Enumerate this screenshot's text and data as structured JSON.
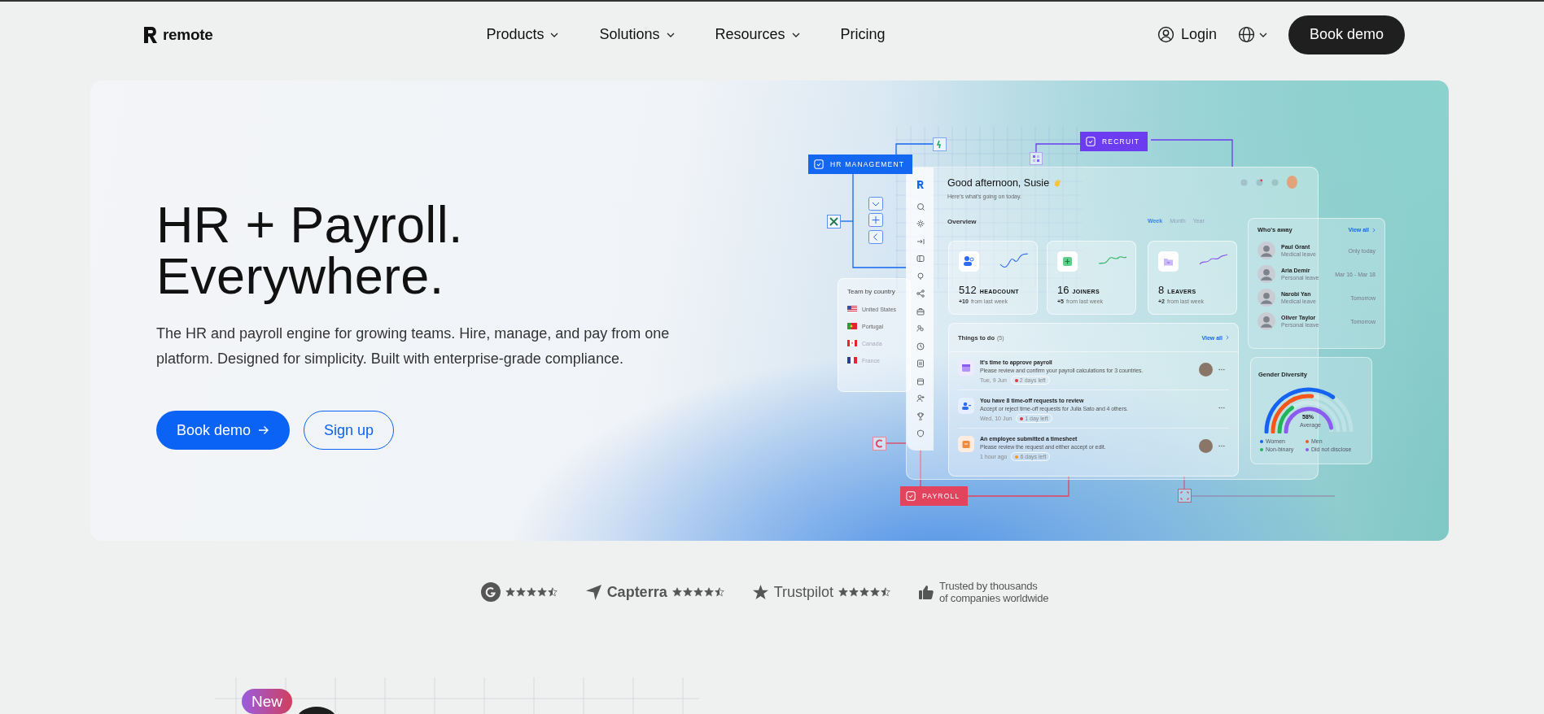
{
  "header": {
    "logo": "remote",
    "nav": [
      {
        "label": "Products",
        "dropdown": true
      },
      {
        "label": "Solutions",
        "dropdown": true
      },
      {
        "label": "Resources",
        "dropdown": true
      },
      {
        "label": "Pricing",
        "dropdown": false
      }
    ],
    "login": "Login",
    "cta": "Book demo"
  },
  "hero": {
    "title_lines": [
      "HR + Payroll.",
      "Everywhere."
    ],
    "description": "The HR and payroll engine for growing teams. Hire, manage, and pay from one platform. Designed for simplicity. Built with enterprise-grade compliance.",
    "buttons": [
      {
        "label": "Book demo",
        "kind": "primary"
      },
      {
        "label": "Sign up",
        "kind": "outline"
      }
    ]
  },
  "illustration": {
    "tags": [
      {
        "label": "HR MANAGEMENT",
        "color": "#1467f0"
      },
      {
        "label": "RECRUIT",
        "color": "#6b3cf0"
      },
      {
        "label": "PAYROLL",
        "color": "#e2435d"
      }
    ],
    "team_by_country": {
      "title": "Team by country",
      "countries": [
        {
          "name": "United States",
          "kind": "us"
        },
        {
          "name": "Portugal",
          "kind": "pt"
        },
        {
          "name": "Canada",
          "kind": "ca"
        },
        {
          "name": "France",
          "kind": "fr"
        }
      ]
    },
    "dashboard": {
      "greeting": "Good afternoon, Susie",
      "subtitle": "Here's what's going on today.",
      "overview": "Overview",
      "periods": [
        {
          "label": "Week",
          "selected": true
        },
        {
          "label": "Month",
          "selected": false
        },
        {
          "label": "Year",
          "selected": false
        }
      ],
      "stats": [
        {
          "kind": "headcount",
          "value": "512",
          "label": "HEADCOUNT",
          "change": "+10",
          "note": "from last week"
        },
        {
          "kind": "joiners",
          "value": "16",
          "label": "JOINERS",
          "change": "+5",
          "note": "from last week"
        },
        {
          "kind": "leavers",
          "value": "8",
          "label": "LEAVERS",
          "change": "+2",
          "note": "from last week"
        }
      ],
      "todo": {
        "title": "Things to do",
        "count": "(5)",
        "view_all": "View all",
        "items": [
          {
            "kind": "payroll",
            "title": "It's time to approve payroll",
            "description": "Please review and confirm your payroll calculations for 3 countries.",
            "date": "Tue, 9 Jun",
            "due": "2 days left",
            "color": "#e5363d",
            "avatar": true
          },
          {
            "kind": "time-off",
            "title": "You have 8 time-off requests to review",
            "description": "Accept or reject time-off requests for Julia Sato and 4 others.",
            "date": "Wed, 10 Jun",
            "due": "1 day left",
            "color": "#e5363d",
            "avatar": false
          },
          {
            "kind": "timesheet",
            "title": "An employee submitted a timesheet",
            "description": "Please review the request and either accept or edit.",
            "date": "1 hour ago",
            "due": "6 days left",
            "color": "#f39a1e",
            "avatar": true
          }
        ]
      }
    },
    "away": {
      "title": "Who's away",
      "view_all": "View all",
      "people": [
        {
          "name": "Paul Grant",
          "reason": "Medical leave",
          "when": "Only today"
        },
        {
          "name": "Aria Demir",
          "reason": "Personal leave",
          "when": "Mar 16 - Mar 18"
        },
        {
          "name": "Narobi Yan",
          "reason": "Medical leave",
          "when": "Tomorrow"
        },
        {
          "name": "Oliver Taylor",
          "reason": "Personal leave",
          "when": "Tomorrow"
        }
      ]
    },
    "gender": {
      "title": "Gender Diversity",
      "value": "58%",
      "caption": "Average",
      "legend": [
        {
          "label": "Women",
          "color": "#1463f3"
        },
        {
          "label": "Men",
          "color": "#f5561e"
        },
        {
          "label": "Non-binary",
          "color": "#20b558"
        },
        {
          "label": "Did not disclose",
          "color": "#8a5cf0"
        }
      ]
    }
  },
  "ratings": {
    "sites": [
      {
        "kind": "g2",
        "stars": 4.5
      },
      {
        "kind": "capterra",
        "name": "Capterra",
        "stars": 4.5
      },
      {
        "kind": "trustpilot",
        "name": "Trustpilot",
        "stars": 4.5
      }
    ],
    "trusted": "Trusted by thousands\nof companies worldwide"
  },
  "next_section": {
    "badge": "New"
  }
}
